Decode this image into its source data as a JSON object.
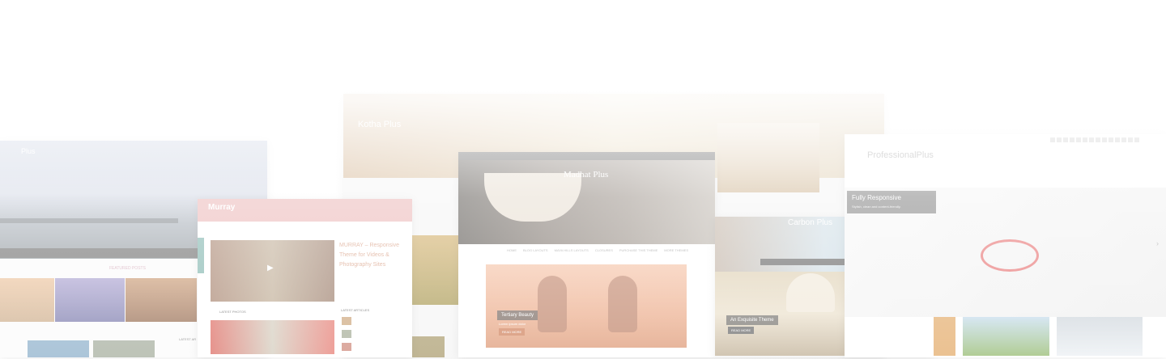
{
  "themes": {
    "left": {
      "logo": "Plus",
      "section_title": "FEATURED POSTS",
      "latest": "LATEST AR"
    },
    "murray": {
      "logo": "Murray",
      "post_title": "MURRAY – Responsive Theme for Videos & Photography Sites",
      "latest_photos": "LATEST PHOTOS",
      "latest_articles": "LATEST ARTICLES"
    },
    "back": {
      "logo": "Kotha Plus"
    },
    "center": {
      "logo": "Madhat Plus",
      "nav": [
        "HOME",
        "BLOG LAYOUTS",
        "MAYA HILLS LAYOUTS",
        "CLOSURES",
        "PURCHASE THIS THEME",
        "MORE THEMES"
      ],
      "slide_title": "Tertiary Beauty",
      "slide_sub": "Lorem ipsum dolor",
      "slide_button": "READ MORE"
    },
    "right_mid": {
      "logo": "Carbon Plus",
      "slide_title": "An Exquisite Theme",
      "slide_button": "READ MORE"
    },
    "professional": {
      "logo": "ProfessionalPlus",
      "badge_title": "Fully Responsive",
      "badge_text": "Stylish, clean and content-friendly."
    }
  },
  "colors": {
    "murray_header": "#e8aaaa",
    "accent": "#c96f44",
    "wash": "#ffffff"
  }
}
